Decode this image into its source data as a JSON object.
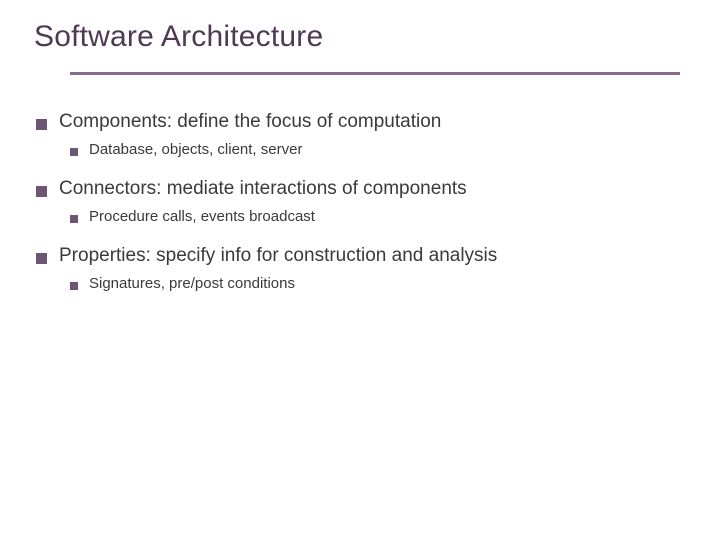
{
  "title": "Software Architecture",
  "items": [
    {
      "text": "Components: define the focus of computation",
      "sub": "Database, objects, client, server"
    },
    {
      "text": "Connectors: mediate interactions of components",
      "sub": "Procedure calls, events broadcast"
    },
    {
      "text": "Properties: specify info for construction and analysis",
      "sub": "Signatures, pre/post conditions"
    }
  ]
}
